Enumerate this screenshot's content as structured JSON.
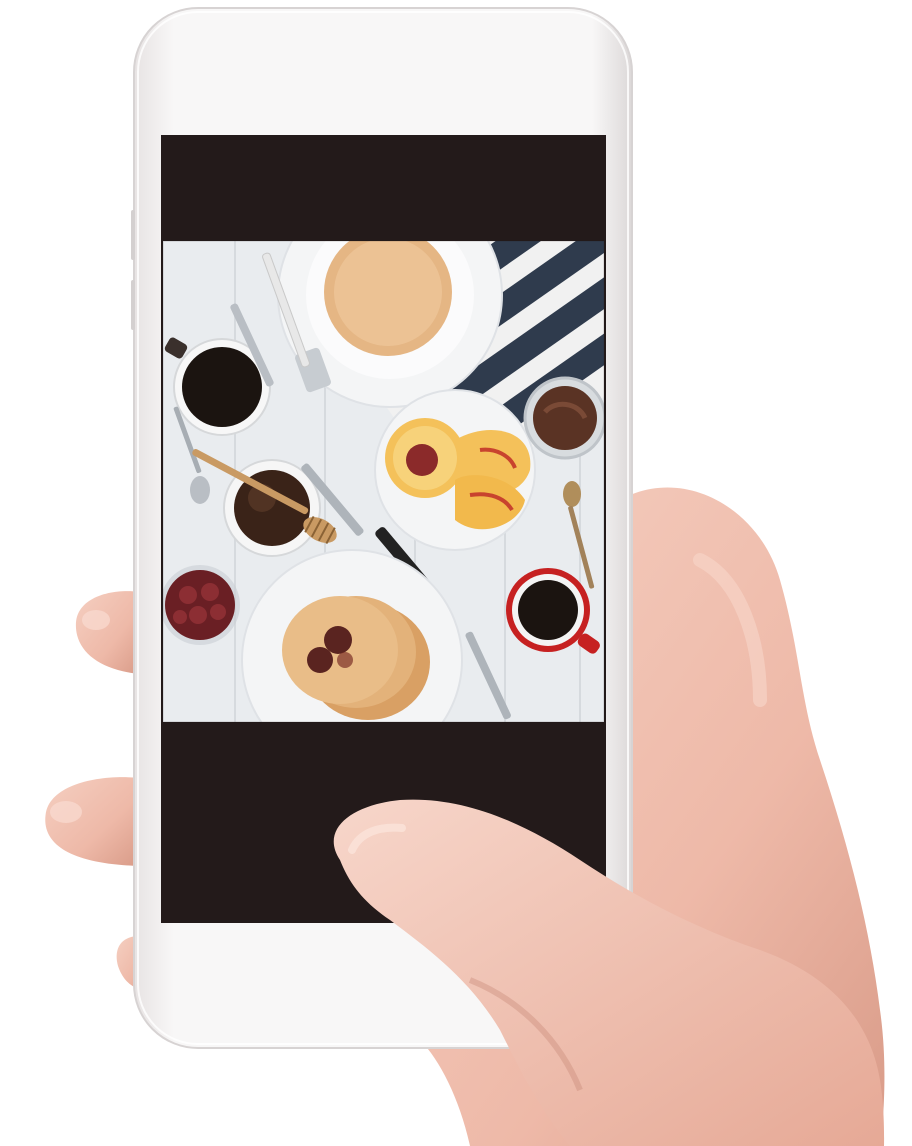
{
  "scene": {
    "description_hidden": "",
    "background_color": "#ffffff",
    "phone": {
      "frame_color": "#f3f1f1",
      "screen_color": "#231a1a",
      "orientation": "portrait"
    },
    "photo": {
      "subject_icons": [
        "plate-icon",
        "pancake-stack-icon",
        "coffee-cup-icon",
        "peach-icon",
        "chocolate-spread-jar-icon",
        "honey-bowl-icon",
        "honey-dipper-icon",
        "jam-bowl-icon",
        "knife-icon",
        "fork-icon",
        "spoon-icon",
        "striped-napkin-icon"
      ],
      "palette": {
        "table": "#e8ebee",
        "plate": "#f4f5f6",
        "pancake": "#e5b684",
        "coffee": "#1b1410",
        "peach": "#f4c15a",
        "peach_red": "#c8432e",
        "napkin_dark": "#2f3b4d",
        "napkin_light": "#f1f1f1",
        "cup_red": "#c62121",
        "jam": "#6a1f24",
        "chocolate": "#5a3324"
      }
    },
    "hand": {
      "skin_color": "#f0c2b2",
      "shadow_color": "#d89d8d"
    }
  }
}
